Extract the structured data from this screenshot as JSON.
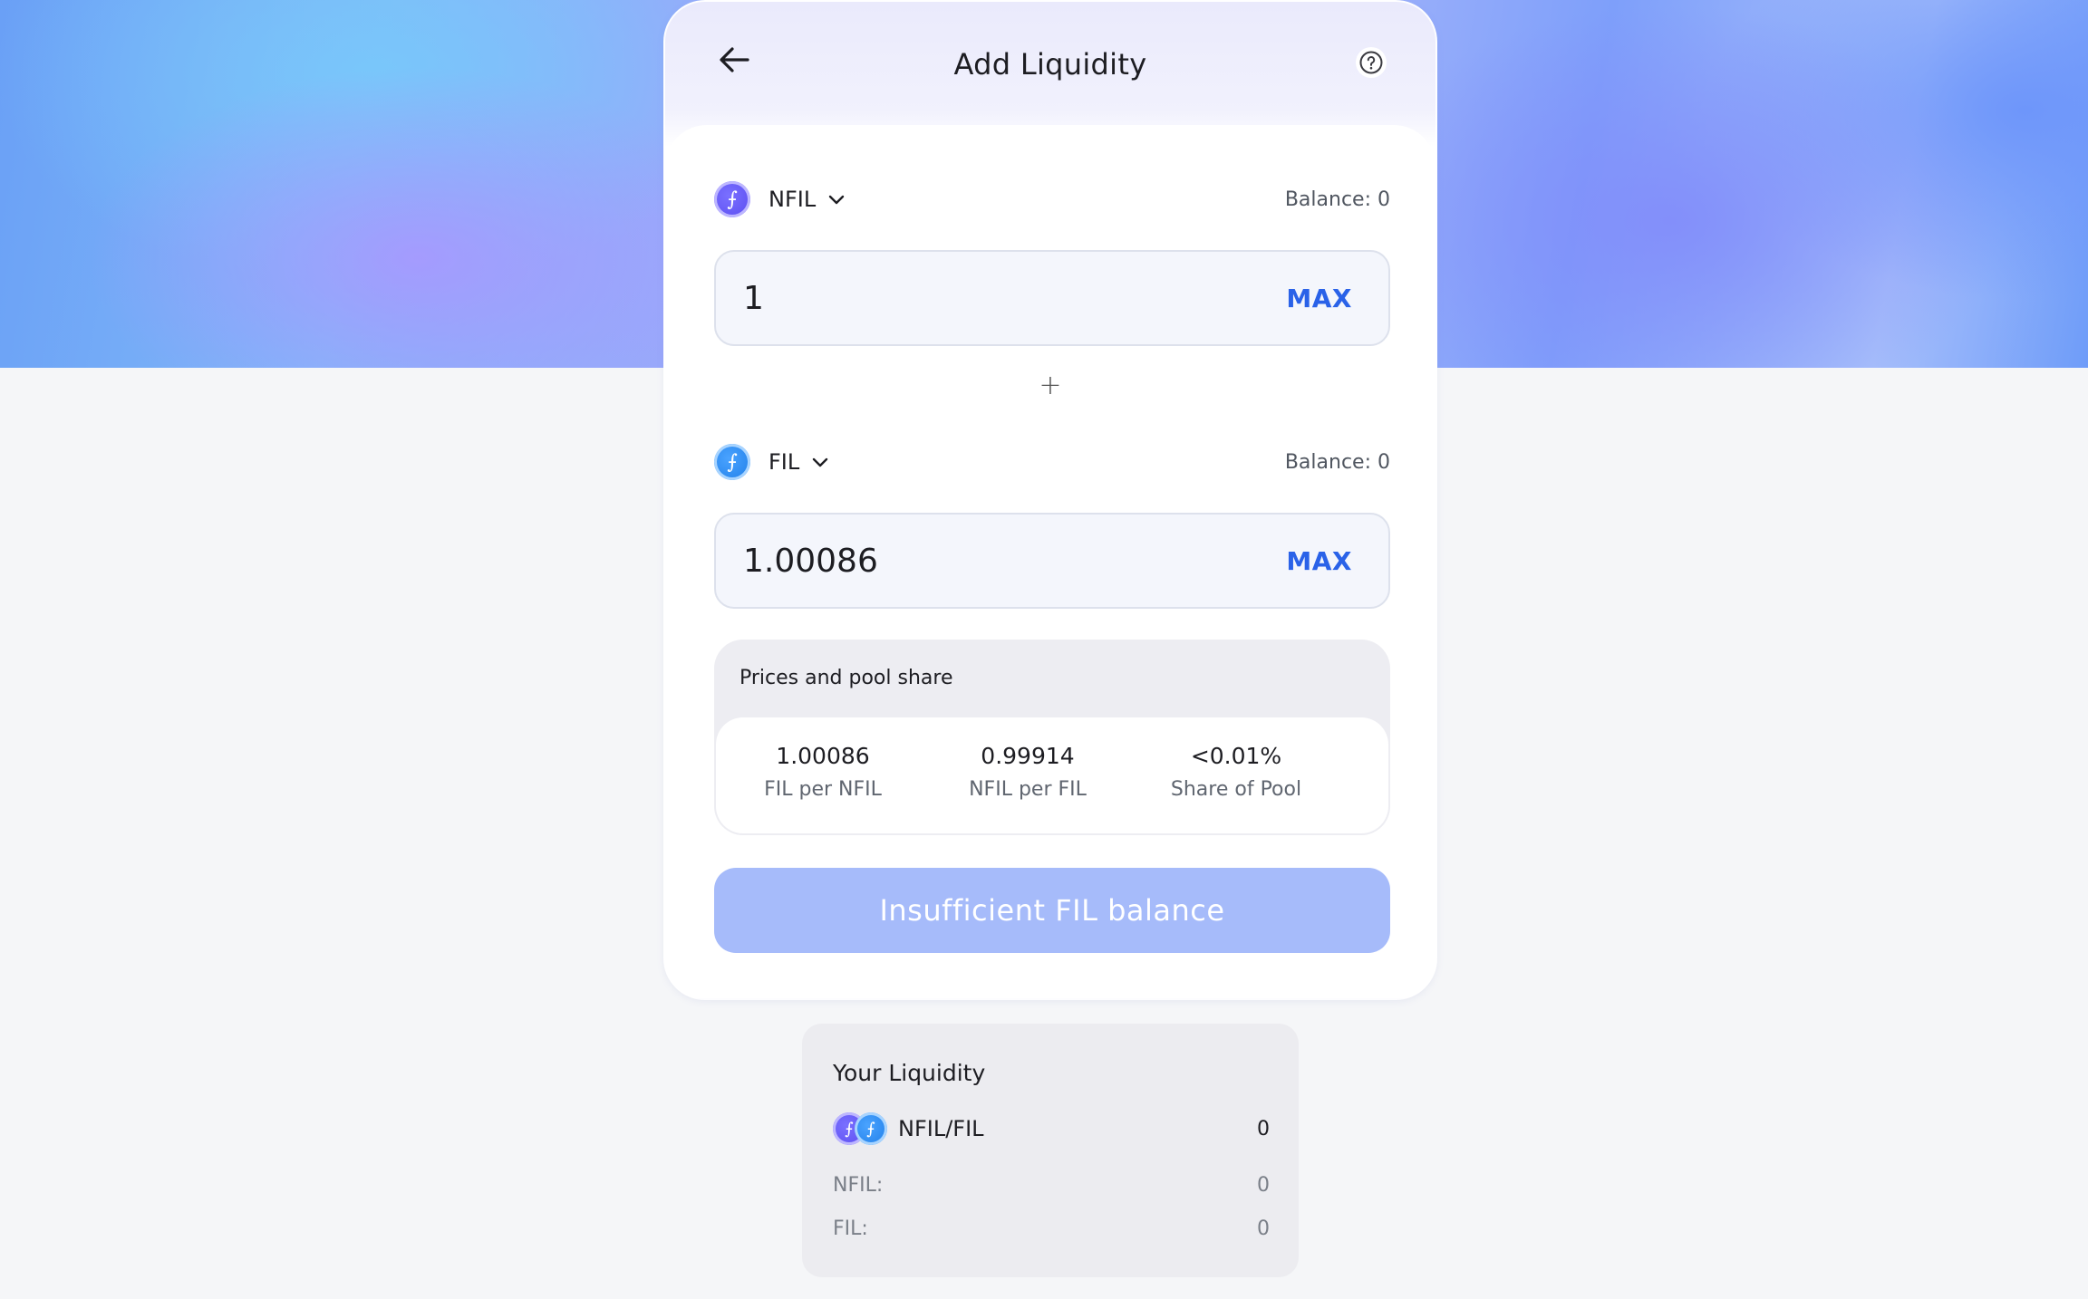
{
  "header": {
    "title": "Add Liquidity",
    "back_icon": "arrow-left-icon",
    "help_icon": "question-circle-icon"
  },
  "token_a": {
    "symbol": "NFIL",
    "balance": "Balance: 0",
    "amount": "1",
    "max_label": "MAX",
    "icon": "filecoin-icon",
    "icon_glyph": "⨍",
    "color": "#5a4cf0"
  },
  "plus_sign": "+",
  "token_b": {
    "symbol": "FIL",
    "balance": "Balance: 0",
    "amount": "1.00086",
    "max_label": "MAX",
    "icon": "filecoin-icon",
    "icon_glyph": "⨍",
    "color": "#1f7ee8"
  },
  "prices": {
    "title": "Prices and pool share",
    "items": [
      {
        "value": "1.00086",
        "label": "FIL per NFIL"
      },
      {
        "value": "0.99914",
        "label": "NFIL per FIL"
      },
      {
        "value": "<0.01%",
        "label": "Share of Pool"
      }
    ]
  },
  "submit": {
    "label": "Insufficient FIL balance",
    "color": "#a6bbfa"
  },
  "your_liquidity": {
    "title": "Your Liquidity",
    "pair": "NFIL/FIL",
    "pair_amount": "0",
    "rows": [
      {
        "label": "NFIL:",
        "value": "0"
      },
      {
        "label": "FIL:",
        "value": "0"
      }
    ]
  },
  "colors": {
    "accent": "#2a62e8",
    "background": "#f5f6f8"
  }
}
